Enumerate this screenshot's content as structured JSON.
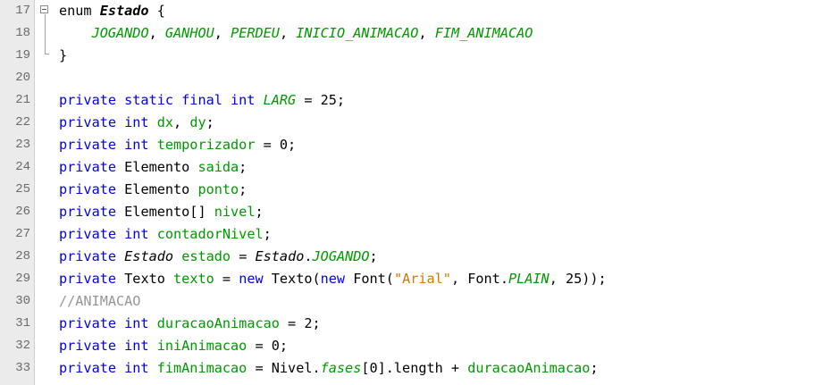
{
  "lines": [
    {
      "n": "17",
      "tokens": [
        {
          "t": "enum ",
          "c": "plain"
        },
        {
          "t": "Estado",
          "c": "bold"
        },
        {
          "t": " {",
          "c": "plain"
        }
      ]
    },
    {
      "n": "18",
      "tokens": [
        {
          "t": "    ",
          "c": "plain"
        },
        {
          "t": "JOGANDO",
          "c": "static"
        },
        {
          "t": ", ",
          "c": "plain"
        },
        {
          "t": "GANHOU",
          "c": "static"
        },
        {
          "t": ", ",
          "c": "plain"
        },
        {
          "t": "PERDEU",
          "c": "static"
        },
        {
          "t": ", ",
          "c": "plain"
        },
        {
          "t": "INICIO_ANIMACAO",
          "c": "static"
        },
        {
          "t": ", ",
          "c": "plain"
        },
        {
          "t": "FIM_ANIMACAO",
          "c": "static"
        }
      ]
    },
    {
      "n": "19",
      "tokens": [
        {
          "t": "}",
          "c": "plain"
        }
      ]
    },
    {
      "n": "20",
      "tokens": []
    },
    {
      "n": "21",
      "tokens": [
        {
          "t": "private static final int ",
          "c": "kw"
        },
        {
          "t": "LARG",
          "c": "static"
        },
        {
          "t": " = 25;",
          "c": "plain"
        }
      ]
    },
    {
      "n": "22",
      "tokens": [
        {
          "t": "private int ",
          "c": "kw"
        },
        {
          "t": "dx",
          "c": "field"
        },
        {
          "t": ", ",
          "c": "plain"
        },
        {
          "t": "dy",
          "c": "field"
        },
        {
          "t": ";",
          "c": "plain"
        }
      ]
    },
    {
      "n": "23",
      "tokens": [
        {
          "t": "private int ",
          "c": "kw"
        },
        {
          "t": "temporizador",
          "c": "field"
        },
        {
          "t": " = 0;",
          "c": "plain"
        }
      ]
    },
    {
      "n": "24",
      "tokens": [
        {
          "t": "private ",
          "c": "kw"
        },
        {
          "t": "Elemento ",
          "c": "plain"
        },
        {
          "t": "saida",
          "c": "field"
        },
        {
          "t": ";",
          "c": "plain"
        }
      ]
    },
    {
      "n": "25",
      "tokens": [
        {
          "t": "private ",
          "c": "kw"
        },
        {
          "t": "Elemento ",
          "c": "plain"
        },
        {
          "t": "ponto",
          "c": "field"
        },
        {
          "t": ";",
          "c": "plain"
        }
      ]
    },
    {
      "n": "26",
      "tokens": [
        {
          "t": "private ",
          "c": "kw"
        },
        {
          "t": "Elemento[] ",
          "c": "plain"
        },
        {
          "t": "nivel",
          "c": "field"
        },
        {
          "t": ";",
          "c": "plain"
        }
      ]
    },
    {
      "n": "27",
      "tokens": [
        {
          "t": "private int ",
          "c": "kw"
        },
        {
          "t": "contadorNivel",
          "c": "field"
        },
        {
          "t": ";",
          "c": "plain"
        }
      ]
    },
    {
      "n": "28",
      "tokens": [
        {
          "t": "private ",
          "c": "kw"
        },
        {
          "t": "Estado",
          "c": "typeit"
        },
        {
          "t": " ",
          "c": "plain"
        },
        {
          "t": "estado",
          "c": "field"
        },
        {
          "t": " = ",
          "c": "plain"
        },
        {
          "t": "Estado",
          "c": "typeit"
        },
        {
          "t": ".",
          "c": "plain"
        },
        {
          "t": "JOGANDO",
          "c": "static"
        },
        {
          "t": ";",
          "c": "plain"
        }
      ]
    },
    {
      "n": "29",
      "tokens": [
        {
          "t": "private ",
          "c": "kw"
        },
        {
          "t": "Texto ",
          "c": "plain"
        },
        {
          "t": "texto",
          "c": "field"
        },
        {
          "t": " = ",
          "c": "plain"
        },
        {
          "t": "new ",
          "c": "kw"
        },
        {
          "t": "Texto(",
          "c": "plain"
        },
        {
          "t": "new ",
          "c": "kw"
        },
        {
          "t": "Font(",
          "c": "plain"
        },
        {
          "t": "\"Arial\"",
          "c": "str"
        },
        {
          "t": ", Font.",
          "c": "plain"
        },
        {
          "t": "PLAIN",
          "c": "static"
        },
        {
          "t": ", 25));",
          "c": "plain"
        }
      ]
    },
    {
      "n": "30",
      "tokens": [
        {
          "t": "//ANIMACAO",
          "c": "com"
        }
      ]
    },
    {
      "n": "31",
      "tokens": [
        {
          "t": "private int ",
          "c": "kw"
        },
        {
          "t": "duracaoAnimacao",
          "c": "field"
        },
        {
          "t": " = 2;",
          "c": "plain"
        }
      ]
    },
    {
      "n": "32",
      "tokens": [
        {
          "t": "private int ",
          "c": "kw"
        },
        {
          "t": "iniAnimacao",
          "c": "field"
        },
        {
          "t": " = 0;",
          "c": "plain"
        }
      ]
    },
    {
      "n": "33",
      "tokens": [
        {
          "t": "private int ",
          "c": "kw"
        },
        {
          "t": "fimAnimacao",
          "c": "field"
        },
        {
          "t": " = Nivel.",
          "c": "plain"
        },
        {
          "t": "fases",
          "c": "static"
        },
        {
          "t": "[0].length + ",
          "c": "plain"
        },
        {
          "t": "duracaoAnimacao",
          "c": "field"
        },
        {
          "t": ";",
          "c": "plain"
        }
      ]
    }
  ],
  "colors": {
    "keyword": "#0000e6",
    "field": "#009900",
    "string": "#ce7b00",
    "comment": "#969696",
    "gutter": "#ebebeb"
  }
}
